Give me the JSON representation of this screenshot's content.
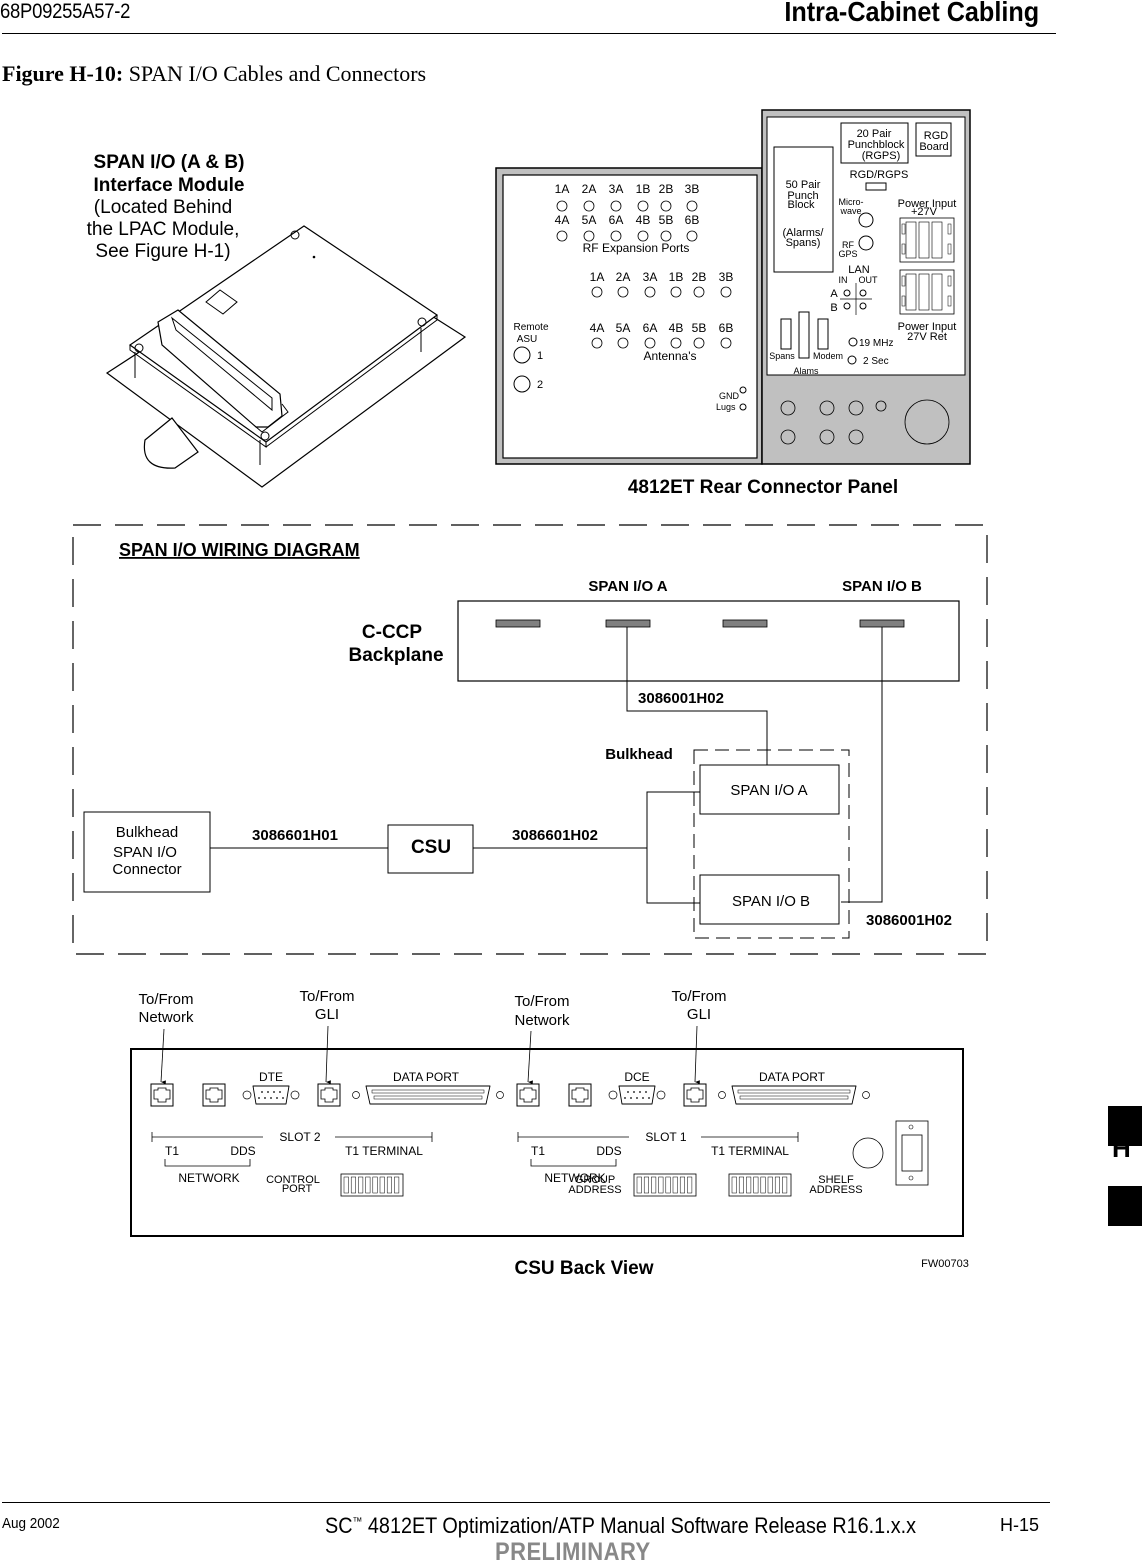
{
  "header": {
    "doc_number": "68P09255A57-2",
    "section_title": "Intra-Cabinet  Cabling"
  },
  "figure": {
    "label": "Figure H-10:",
    "title": "SPAN I/O Cables and Connectors",
    "id_code": "FW00703"
  },
  "interface_module": {
    "title_line1": "SPAN I/O (A & B)",
    "title_line2": "Interface Module",
    "note_line1": "(Located Behind",
    "note_line2": "the LPAC Module,",
    "note_line3": "See Figure H-1)"
  },
  "rear_panel": {
    "caption": "4812ET Rear Connector Panel",
    "rf_expansion": {
      "row1": [
        "1A",
        "2A",
        "3A",
        "1B",
        "2B",
        "3B"
      ],
      "row2": [
        "4A",
        "5A",
        "6A",
        "4B",
        "5B",
        "6B"
      ],
      "label": "RF Expansion Ports"
    },
    "antennas": {
      "row1": [
        "1A",
        "2A",
        "3A",
        "1B",
        "2B",
        "3B"
      ],
      "row2": [
        "4A",
        "5A",
        "6A",
        "4B",
        "5B",
        "6B"
      ],
      "label": "Antenna's"
    },
    "remote_asu": {
      "label_line1": "Remote",
      "label_line2": "ASU",
      "ports": [
        "1",
        "2"
      ]
    },
    "gnd": {
      "line1": "GND",
      "line2": "Lugs"
    },
    "right": {
      "punch20_line1": "20 Pair",
      "punch20_line2": "Punchblock",
      "punch20_line3": "(RGPS)",
      "rgd_line1": "RGD",
      "rgd_line2": "Board",
      "rgd_rgps": "RGD/RGPS",
      "punch50_line1": "50 Pair",
      "punch50_line2": "Punch",
      "punch50_line3": "Block",
      "punch50_line4": "(Alarms/",
      "punch50_line5": "Spans)",
      "microwave_line1": "Micro-",
      "microwave_line2": "wave",
      "rf_gps_line1": "RF",
      "rf_gps_line2": "GPS",
      "power_in_line1": "Power Input",
      "power_in_line2": "+27V",
      "power_ret_line1": "Power Input",
      "power_ret_line2": "27V Ret",
      "lan": "LAN",
      "lan_in": "IN",
      "lan_out": "OUT",
      "lan_a": "A",
      "lan_b": "B",
      "spans": "Spans",
      "alams": "Alams",
      "modem": "Modem",
      "mhz19": "19 MHz",
      "sec2": "2 Sec"
    }
  },
  "wiring": {
    "title": "SPAN I/O WIRING DIAGRAM",
    "backplane_line1": "C-CCP",
    "backplane_line2": "Backplane",
    "span_a_label": "SPAN I/O A",
    "span_b_label": "SPAN I/O B",
    "cable_top": "3086001H02",
    "bulkhead_label": "Bulkhead",
    "bulkhead_span_a": "SPAN I/O A",
    "bulkhead_span_b": "SPAN I/O B",
    "bulkhead_conn_line1": "Bulkhead",
    "bulkhead_conn_line2": "SPAN I/O",
    "bulkhead_conn_line3": "Connector",
    "cable_h01": "3086601H01",
    "csu": "CSU",
    "cable_h02_mid": "3086601H02",
    "cable_bottom": "3086001H02"
  },
  "csu_back": {
    "caption": "CSU Back View",
    "callouts": [
      {
        "line1": "To/From",
        "line2": "Network"
      },
      {
        "line1": "To/From",
        "line2": "GLI"
      },
      {
        "line1": "To/From",
        "line2": "Network"
      },
      {
        "line1": "To/From",
        "line2": "GLI"
      }
    ],
    "slot2": {
      "serial_label": "DTE",
      "data_port": "DATA PORT",
      "slot": "SLOT 2",
      "t1": "T1",
      "dds": "DDS",
      "t1_terminal": "T1 TERMINAL",
      "network": "NETWORK"
    },
    "slot1": {
      "serial_label": "DCE",
      "data_port": "DATA PORT",
      "slot": "SLOT 1",
      "t1": "T1",
      "dds": "DDS",
      "t1_terminal": "T1 TERMINAL",
      "network": "NETWORK"
    },
    "control_port_line1": "CONTROL",
    "control_port_line2": "PORT",
    "group_address_line1": "GROUP",
    "group_address_line2": "ADDRESS",
    "shelf_address_line1": "SHELF",
    "shelf_address_line2": "ADDRESS"
  },
  "footer": {
    "date": "Aug 2002",
    "manual_prefix": "SC",
    "trademark": "™",
    "manual_title": "4812ET Optimization/ATP Manual Software Release R16.1.x.x",
    "page": "H-15",
    "status": "PRELIMINARY"
  },
  "side_tab": {
    "letter": "H"
  }
}
